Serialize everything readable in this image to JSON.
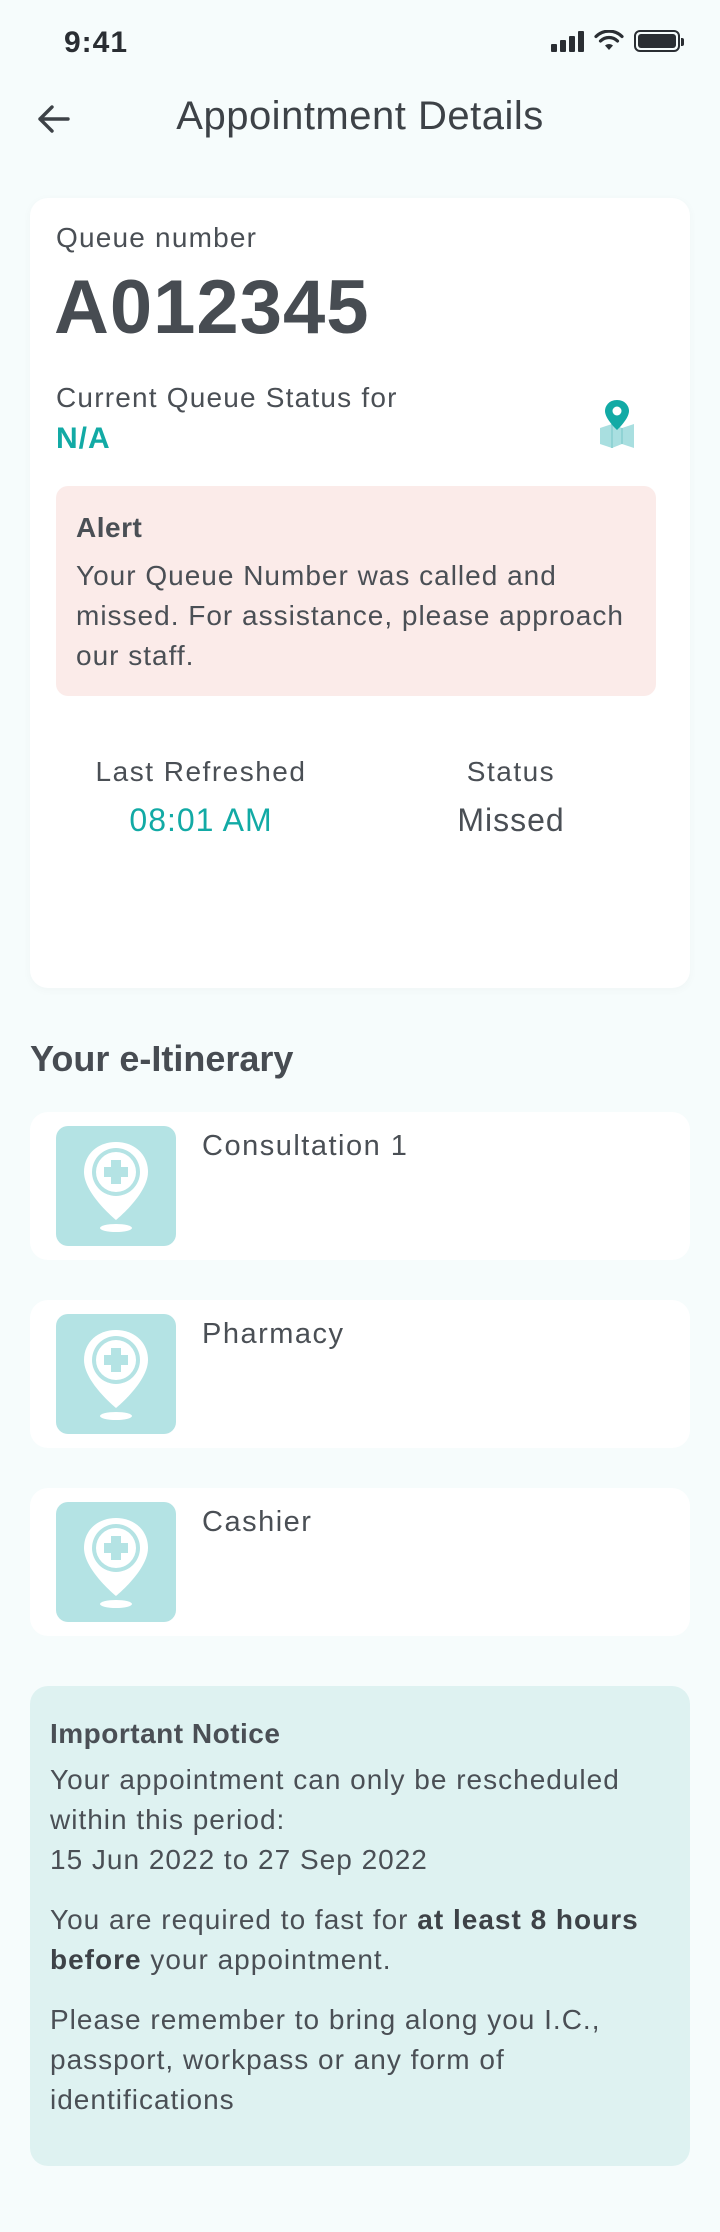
{
  "status_bar": {
    "time": "9:41",
    "signal_icon": "signal-icon",
    "wifi_icon": "wifi-icon",
    "battery_icon": "battery-icon"
  },
  "header": {
    "title": "Appointment Details",
    "back_icon": "arrow-left-icon"
  },
  "queue": {
    "number_label": "Queue number",
    "number": "A012345",
    "current_status_label": "Current Queue Status for",
    "current_status_value": "N/A",
    "map_icon": "map-pin-icon"
  },
  "alert": {
    "title": "Alert",
    "message": "Your Queue Number was called and missed. For assistance, please approach our staff."
  },
  "meta": {
    "last_refreshed_label": "Last Refreshed",
    "last_refreshed_value": "08:01 AM",
    "status_label": "Status",
    "status_value": "Missed"
  },
  "itinerary": {
    "title": "Your e-Itinerary",
    "items": [
      {
        "label": "Consultation 1",
        "icon": "medical-location-icon"
      },
      {
        "label": "Pharmacy",
        "icon": "medical-location-icon"
      },
      {
        "label": "Cashier",
        "icon": "medical-location-icon"
      }
    ]
  },
  "notice": {
    "title": "Important Notice",
    "reschedule_text": "Your appointment can only be rescheduled within this period:",
    "period": "15 Jun 2022 to 27 Sep 2022",
    "fast_prefix": "You are required to fast for ",
    "fast_emphasis": "at least 8 hours before",
    "fast_suffix": " your appointment.",
    "id_text": "Please remember to bring along you I.C., passport, workpass or any form of identifications"
  },
  "colors": {
    "accent": "#12aaa5",
    "alert_bg": "#fbebe9",
    "notice_bg": "#def2f1",
    "icon_tile": "#b4e3e4",
    "page_bg": "#f6fcfc"
  }
}
